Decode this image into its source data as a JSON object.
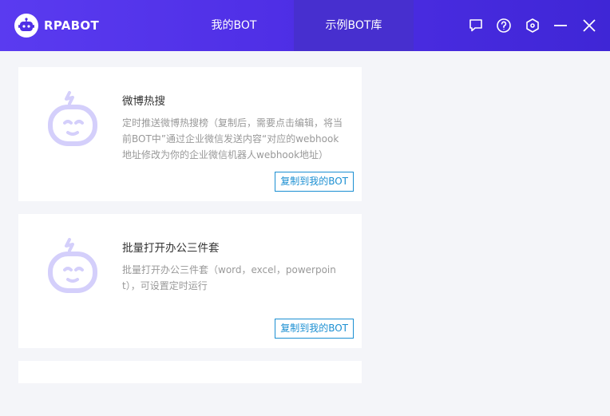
{
  "app": {
    "name": "RPABOT"
  },
  "nav": {
    "tabs": [
      {
        "label": "我的BOT"
      },
      {
        "label": "示例BOT库"
      }
    ]
  },
  "window_controls": [
    "chat-icon",
    "help-icon",
    "settings-hex-icon",
    "minimize-icon",
    "close-icon"
  ],
  "colors": {
    "accent": "#4f2fe6",
    "link": "#1b8fd2",
    "avatar": "#d4cffb"
  },
  "bots": [
    {
      "title": "微博热搜",
      "description": "定时推送微博热搜榜（复制后，需要点击编辑，将当前BOT中”通过企业微信发送内容“对应的webhook地址修改为你的企业微信机器人webhook地址）",
      "action": "复制到我的BOT"
    },
    {
      "title": "批量打开办公三件套",
      "description": "批量打开办公三件套（word，excel，powerpoint），可设置定时运行",
      "action": "复制到我的BOT"
    }
  ]
}
